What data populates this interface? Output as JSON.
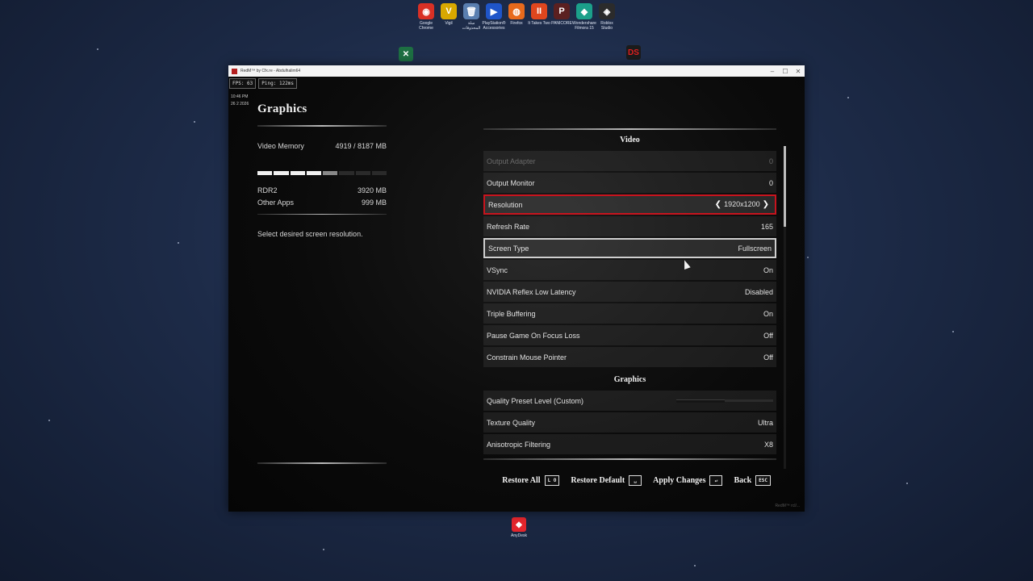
{
  "desktop": {
    "icons": [
      {
        "label": "Google Chrome",
        "glyph": "◉",
        "color": "#d93025",
        "icon": "chrome-icon"
      },
      {
        "label": "Vigil",
        "glyph": "V",
        "color": "#d8a800",
        "icon": "vigil-icon"
      },
      {
        "label": "سلة المحذوفات",
        "glyph": "🗑",
        "color": "#5a7fb0",
        "icon": "recycle-bin-icon"
      },
      {
        "label": "PlayStation® Accessories",
        "glyph": "▶",
        "color": "#1f55c9",
        "icon": "playstation-icon"
      },
      {
        "label": "Firefox",
        "glyph": "◍",
        "color": "#e86a1c",
        "icon": "firefox-icon"
      },
      {
        "label": "It Takes Two",
        "glyph": "II",
        "color": "#e0461e",
        "icon": "it-takes-two-icon"
      },
      {
        "label": "PANICORE",
        "glyph": "P",
        "color": "#5b2020",
        "icon": "panicore-icon"
      },
      {
        "label": "Wondershare Filmora 15",
        "glyph": "◆",
        "color": "#1ba08a",
        "icon": "filmora-icon"
      },
      {
        "label": "Roblox Studio",
        "glyph": "◈",
        "color": "#2b2b2b",
        "icon": "roblox-studio-icon"
      }
    ],
    "anydesk_label": "AnyDesk",
    "anydesk_icon": "anydesk-icon",
    "excel_icon": "excel-icon",
    "ds_icon_text": "DS"
  },
  "window": {
    "title": "RedM™ by Cfx.re - Abdulhalim64",
    "controls": {
      "minimize": "–",
      "maximize": "☐",
      "close": "✕"
    }
  },
  "hud": {
    "fps": "FPS: 63",
    "ping": "Ping: 122ms",
    "time": "10:46 PM",
    "date": "26   2   2026"
  },
  "left": {
    "title": "Graphics",
    "video_memory_label": "Video Memory",
    "video_memory_value": "4919  /  8187 MB",
    "memory_usage_fraction": 0.6,
    "rdr2_label": "RDR2",
    "rdr2_value": "3920 MB",
    "other_apps_label": "Other Apps",
    "other_apps_value": "999 MB",
    "description": "Select desired screen resolution."
  },
  "video": {
    "heading": "Video",
    "rows": [
      {
        "label": "Output Adapter",
        "value": "0",
        "state": "dimmed"
      },
      {
        "label": "Output Monitor",
        "value": "0",
        "state": ""
      },
      {
        "label": "Resolution",
        "value": "1920x1200",
        "state": "selected"
      },
      {
        "label": "Refresh Rate",
        "value": "165",
        "state": ""
      },
      {
        "label": "Screen Type",
        "value": "Fullscreen",
        "state": "hover"
      },
      {
        "label": "VSync",
        "value": "On",
        "state": ""
      },
      {
        "label": "NVIDIA Reflex Low Latency",
        "value": "Disabled",
        "state": ""
      },
      {
        "label": "Triple Buffering",
        "value": "On",
        "state": ""
      },
      {
        "label": "Pause Game On Focus Loss",
        "value": "Off",
        "state": ""
      },
      {
        "label": "Constrain Mouse Pointer",
        "value": "Off",
        "state": ""
      }
    ]
  },
  "graphics": {
    "heading": "Graphics",
    "quality_preset_label": "Quality Preset Level (Custom)",
    "quality_preset_fraction": 0.5,
    "rows": [
      {
        "label": "Texture Quality",
        "value": "Ultra"
      },
      {
        "label": "Anisotropic Filtering",
        "value": "X8"
      }
    ]
  },
  "footer": {
    "restore_all": "Restore All",
    "restore_all_key": "L O",
    "restore_default": "Restore Default",
    "restore_default_key": "␣",
    "apply_changes": "Apply Changes",
    "apply_changes_key": "↵",
    "back": "Back",
    "back_key": "ESC"
  },
  "watermark": "RedM™ rcl/..."
}
